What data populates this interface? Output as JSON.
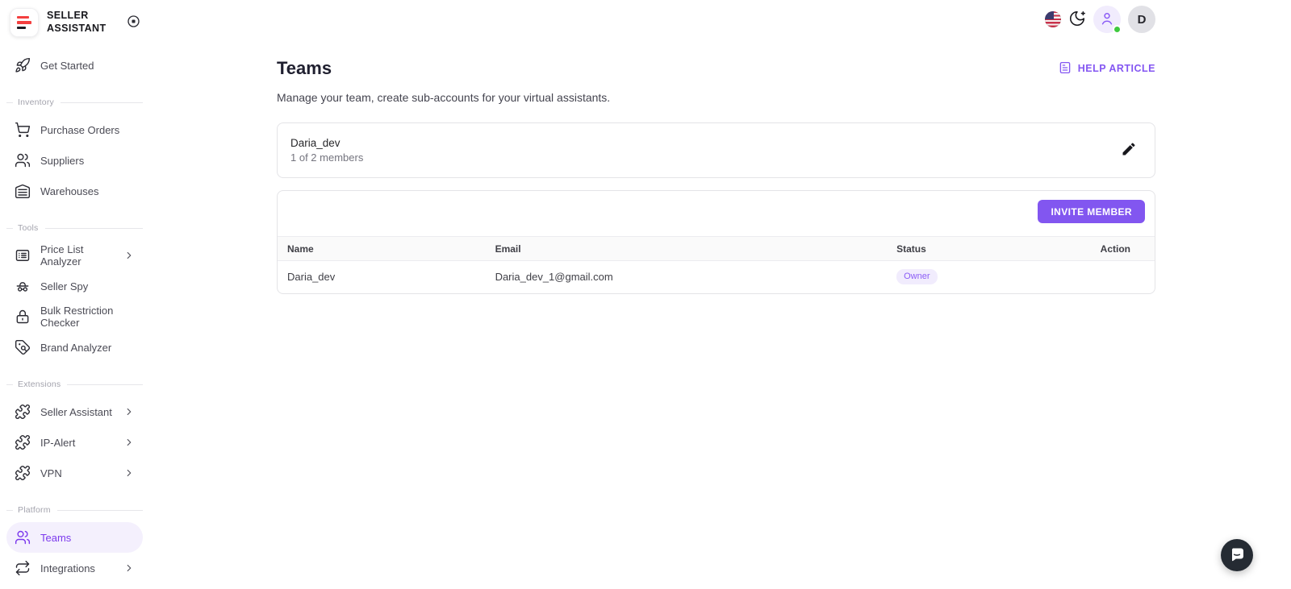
{
  "brand": {
    "title_line1": "SELLER",
    "title_line2": "ASSISTANT",
    "logo_red": "#f43f3f",
    "logo_dark": "#1d1d24"
  },
  "sidebar": {
    "get_started": "Get Started",
    "sections": [
      {
        "label": "Inventory",
        "items": [
          {
            "label": "Purchase Orders",
            "icon": "cart-icon"
          },
          {
            "label": "Suppliers",
            "icon": "people-icon"
          },
          {
            "label": "Warehouses",
            "icon": "warehouse-icon"
          }
        ]
      },
      {
        "label": "Tools",
        "items": [
          {
            "label": "Price List Analyzer",
            "icon": "price-list-icon",
            "chevron": true
          },
          {
            "label": "Seller Spy",
            "icon": "spy-icon"
          },
          {
            "label": "Bulk Restriction Checker",
            "icon": "lock-icon"
          },
          {
            "label": "Brand Analyzer",
            "icon": "tag-search-icon"
          }
        ]
      },
      {
        "label": "Extensions",
        "items": [
          {
            "label": "Seller Assistant",
            "icon": "puzzle-icon",
            "chevron": true
          },
          {
            "label": "IP-Alert",
            "icon": "puzzle-icon",
            "chevron": true
          },
          {
            "label": "VPN",
            "icon": "puzzle-icon",
            "chevron": true
          }
        ]
      },
      {
        "label": "Platform",
        "items": [
          {
            "label": "Teams",
            "icon": "people-icon",
            "active": true
          },
          {
            "label": "Integrations",
            "icon": "repeat-icon",
            "chevron": true
          }
        ]
      }
    ]
  },
  "topbar": {
    "flag_icon": "us-flag-icon",
    "theme_icon": "moon-stars-icon",
    "profile_icon": "person-icon",
    "online_status_color": "#3fc93f",
    "avatar_initial": "D"
  },
  "main": {
    "title": "Teams",
    "subtitle": "Manage your team, create sub-accounts for your virtual assistants.",
    "help_link": "HELP ARTICLE",
    "team_card": {
      "name": "Daria_dev",
      "members": "1 of 2 members",
      "edit_icon": "pencil-icon"
    },
    "invite_button": "INVITE MEMBER",
    "table": {
      "headers": [
        "Name",
        "Email",
        "Status",
        "Action"
      ],
      "rows": [
        {
          "name": "Daria_dev",
          "email": "Daria_dev_1@gmail.com",
          "status": "Owner",
          "action": ""
        }
      ]
    }
  },
  "colors": {
    "accent": "#8256f0",
    "accent_text": "#7c3aed",
    "badge_bg": "#f1ecfd",
    "badge_text": "#8b5cf6",
    "active_pill_bg": "#f4f0fd"
  }
}
